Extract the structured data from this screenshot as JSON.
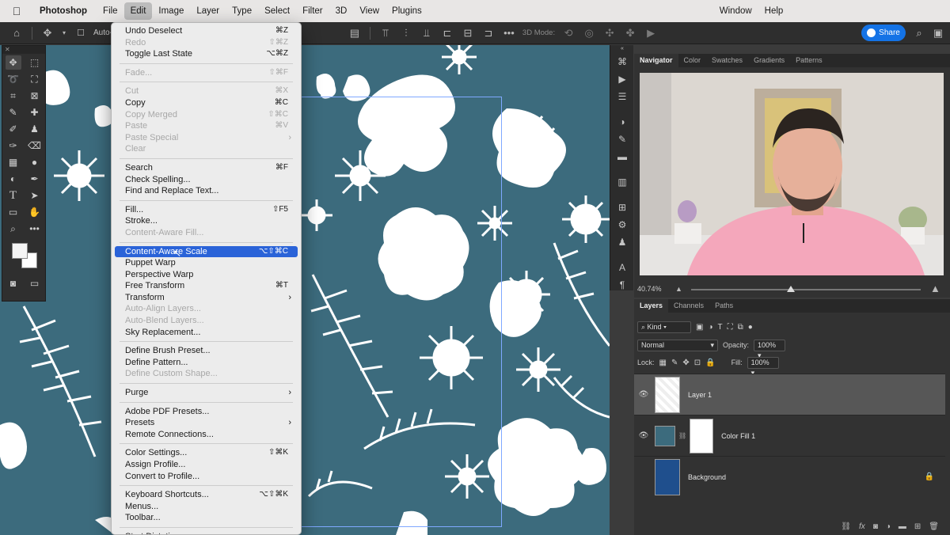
{
  "menubar": {
    "app": "Photoshop",
    "items": [
      "File",
      "Edit",
      "Image",
      "Layer",
      "Type",
      "Select",
      "Filter",
      "3D",
      "View",
      "Plugins"
    ],
    "right_items": [
      "Window",
      "Help"
    ]
  },
  "options_bar": {
    "auto_select_label": "Auto-Sele",
    "mode_3d_label": "3D Mode:",
    "share_label": "Share"
  },
  "edit_menu": {
    "items": [
      {
        "label": "Undo Deselect",
        "shortcut": "⌘Z",
        "disabled": false
      },
      {
        "label": "Redo",
        "shortcut": "⇧⌘Z",
        "disabled": true
      },
      {
        "label": "Toggle Last State",
        "shortcut": "⌥⌘Z",
        "disabled": false
      },
      {
        "sep": true
      },
      {
        "label": "Fade...",
        "shortcut": "⇧⌘F",
        "disabled": true
      },
      {
        "sep": true
      },
      {
        "label": "Cut",
        "shortcut": "⌘X",
        "disabled": true
      },
      {
        "label": "Copy",
        "shortcut": "⌘C",
        "disabled": false
      },
      {
        "label": "Copy Merged",
        "shortcut": "⇧⌘C",
        "disabled": true
      },
      {
        "label": "Paste",
        "shortcut": "⌘V",
        "disabled": true
      },
      {
        "label": "Paste Special",
        "shortcut": "",
        "disabled": true,
        "submenu": true
      },
      {
        "label": "Clear",
        "shortcut": "",
        "disabled": true
      },
      {
        "sep": true
      },
      {
        "label": "Search",
        "shortcut": "⌘F",
        "disabled": false
      },
      {
        "label": "Check Spelling...",
        "shortcut": "",
        "disabled": false
      },
      {
        "label": "Find and Replace Text...",
        "shortcut": "",
        "disabled": false
      },
      {
        "sep": true
      },
      {
        "label": "Fill...",
        "shortcut": "⇧F5",
        "disabled": false
      },
      {
        "label": "Stroke...",
        "shortcut": "",
        "disabled": false
      },
      {
        "label": "Content-Aware Fill...",
        "shortcut": "",
        "disabled": true
      },
      {
        "sep": true
      },
      {
        "label": "Content-Aware Scale",
        "shortcut": "⌥⇧⌘C",
        "disabled": false,
        "selected": true
      },
      {
        "label": "Puppet Warp",
        "shortcut": "",
        "disabled": false
      },
      {
        "label": "Perspective Warp",
        "shortcut": "",
        "disabled": false
      },
      {
        "label": "Free Transform",
        "shortcut": "⌘T",
        "disabled": false
      },
      {
        "label": "Transform",
        "shortcut": "",
        "disabled": false,
        "submenu": true
      },
      {
        "label": "Auto-Align Layers...",
        "shortcut": "",
        "disabled": true
      },
      {
        "label": "Auto-Blend Layers...",
        "shortcut": "",
        "disabled": true
      },
      {
        "label": "Sky Replacement...",
        "shortcut": "",
        "disabled": false
      },
      {
        "sep": true
      },
      {
        "label": "Define Brush Preset...",
        "shortcut": "",
        "disabled": false
      },
      {
        "label": "Define Pattern...",
        "shortcut": "",
        "disabled": false
      },
      {
        "label": "Define Custom Shape...",
        "shortcut": "",
        "disabled": true
      },
      {
        "sep": true
      },
      {
        "label": "Purge",
        "shortcut": "",
        "disabled": false,
        "submenu": true
      },
      {
        "sep": true
      },
      {
        "label": "Adobe PDF Presets...",
        "shortcut": "",
        "disabled": false
      },
      {
        "label": "Presets",
        "shortcut": "",
        "disabled": false,
        "submenu": true
      },
      {
        "label": "Remote Connections...",
        "shortcut": "",
        "disabled": false
      },
      {
        "sep": true
      },
      {
        "label": "Color Settings...",
        "shortcut": "⇧⌘K",
        "disabled": false
      },
      {
        "label": "Assign Profile...",
        "shortcut": "",
        "disabled": false
      },
      {
        "label": "Convert to Profile...",
        "shortcut": "",
        "disabled": false
      },
      {
        "sep": true
      },
      {
        "label": "Keyboard Shortcuts...",
        "shortcut": "⌥⇧⌘K",
        "disabled": false
      },
      {
        "label": "Menus...",
        "shortcut": "",
        "disabled": false
      },
      {
        "label": "Toolbar...",
        "shortcut": "",
        "disabled": false
      },
      {
        "sep": true
      },
      {
        "label": "Start Dictation...",
        "shortcut": "",
        "disabled": false
      }
    ]
  },
  "navigator": {
    "tabs": [
      "Navigator",
      "Color",
      "Swatches",
      "Gradients",
      "Patterns"
    ],
    "zoom": "40.74%"
  },
  "layers": {
    "tabs": [
      "Layers",
      "Channels",
      "Paths"
    ],
    "kind_label": "Kind",
    "blend_mode": "Normal",
    "opacity_label": "Opacity:",
    "opacity_value": "100%",
    "lock_label": "Lock:",
    "fill_label": "Fill:",
    "fill_value": "100%",
    "items": [
      {
        "name": "Layer 1"
      },
      {
        "name": "Color Fill 1"
      },
      {
        "name": "Background"
      }
    ]
  },
  "colors": {
    "canvas_bg": "#3c6b7d",
    "menu_highlight": "#2a63d8",
    "share_button": "#1473e6"
  }
}
